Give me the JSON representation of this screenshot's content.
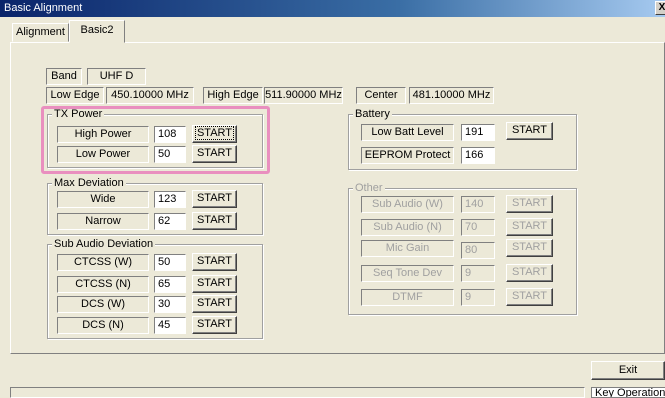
{
  "window": {
    "title": "Basic Alignment",
    "close": "X"
  },
  "tabs": [
    "Alignment",
    "Basic2"
  ],
  "band": {
    "label": "Band",
    "value": "UHF D"
  },
  "edges": {
    "low_label": "Low Edge",
    "low_value": "450.10000 MHz",
    "high_label": "High Edge",
    "high_value": "511.90000 MHz",
    "center_label": "Center",
    "center_value": "481.10000 MHz"
  },
  "tx_power": {
    "title": "TX Power",
    "rows": [
      {
        "label": "High Power",
        "value": "108",
        "button": "START"
      },
      {
        "label": "Low Power",
        "value": "50",
        "button": "START"
      }
    ]
  },
  "max_deviation": {
    "title": "Max Deviation",
    "rows": [
      {
        "label": "Wide",
        "value": "123",
        "button": "START"
      },
      {
        "label": "Narrow",
        "value": "62",
        "button": "START"
      }
    ]
  },
  "sub_audio_deviation": {
    "title": "Sub Audio Deviation",
    "rows": [
      {
        "label": "CTCSS (W)",
        "value": "50",
        "button": "START"
      },
      {
        "label": "CTCSS (N)",
        "value": "65",
        "button": "START"
      },
      {
        "label": "DCS (W)",
        "value": "30",
        "button": "START"
      },
      {
        "label": "DCS (N)",
        "value": "45",
        "button": "START"
      }
    ]
  },
  "battery": {
    "title": "Battery",
    "rows": [
      {
        "label": "Low Batt Level",
        "value": "191",
        "button": "START"
      },
      {
        "label": "EEPROM Protect",
        "value": "166"
      }
    ]
  },
  "other": {
    "title": "Other",
    "rows": [
      {
        "label": "Sub Audio (W)",
        "value": "140",
        "button": "START"
      },
      {
        "label": "Sub Audio (N)",
        "value": "70",
        "button": "START"
      },
      {
        "label": "Mic Gain",
        "value": "80",
        "button": "START"
      },
      {
        "label": "Seq Tone Dev",
        "value": "9",
        "button": "START"
      },
      {
        "label": "DTMF",
        "value": "9",
        "button": "START"
      }
    ]
  },
  "exit_button": "Exit",
  "status": {
    "key_operation": "Key Operation"
  },
  "colors": {
    "highlight": "#e98fbf",
    "titlebar": "#0a246a"
  }
}
